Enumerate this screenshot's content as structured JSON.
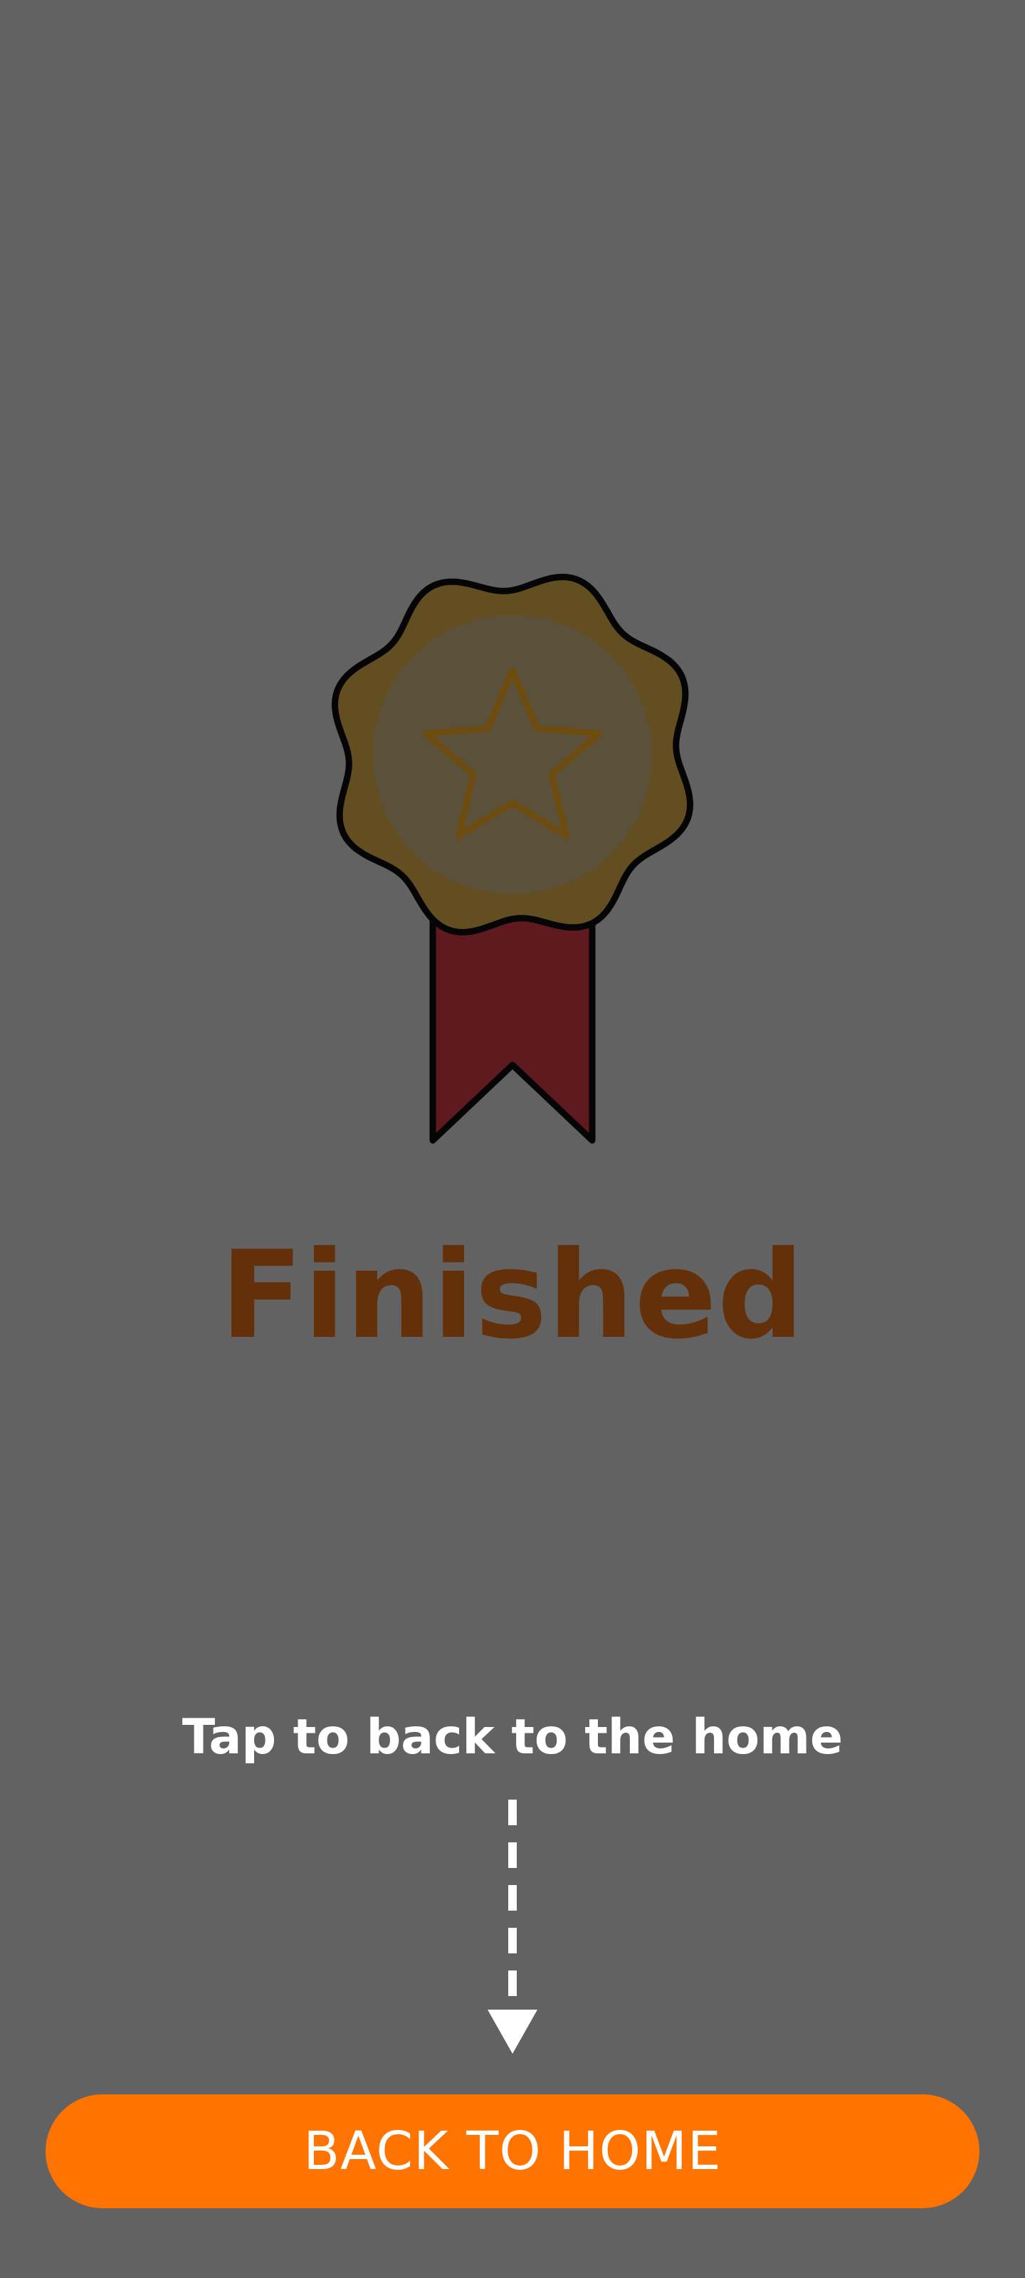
{
  "colors": {
    "background": "#626262",
    "title": "#64300A",
    "hint": "#FFFFFF",
    "button_bg": "#FF7300",
    "button_text": "#FFFFFF",
    "medal_outer": "#634E22",
    "medal_inner": "#5B513A",
    "star_stroke": "#6E4C10",
    "ribbon": "#5E1A1F",
    "outline": "#050505"
  },
  "icons": {
    "badge": "award-ribbon-medal-icon",
    "star": "star-icon",
    "arrow": "dashed-down-arrow-icon"
  },
  "result": {
    "title": "Finished"
  },
  "hint": {
    "text": "Tap to back to the home"
  },
  "button": {
    "label": "BACK TO HOME"
  }
}
